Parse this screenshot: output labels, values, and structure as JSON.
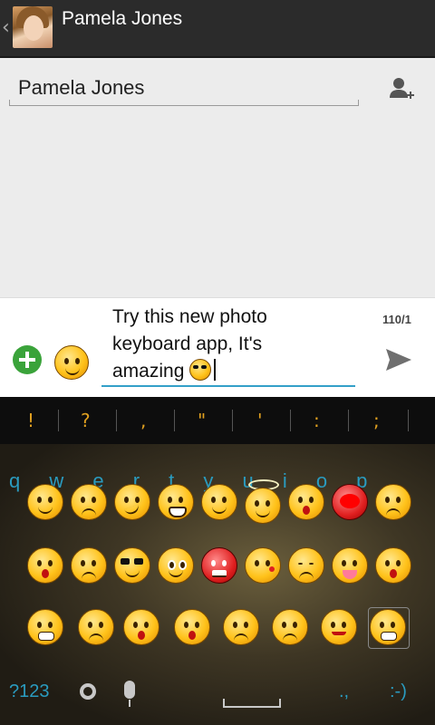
{
  "header": {
    "back_icon": "chevron-left-icon",
    "contact_name": "Pamela Jones"
  },
  "recipient": {
    "value": "Pamela Jones",
    "add_contact_icon": "add-person-icon"
  },
  "compose": {
    "message": "Try this new photo keyboard app, It's amazing",
    "counter": "110/1",
    "add_icon": "plus-circle-icon",
    "emoji_icon": "smiley-icon",
    "send_icon": "send-icon"
  },
  "keyboard": {
    "punctuation": [
      "!",
      "?",
      ",",
      "\"",
      "'",
      ":",
      ";"
    ],
    "ghost_letters": "q w e r t y u i o p",
    "symbols_label": "?123",
    "comma_label": ".,",
    "smiley_label": ":-)",
    "colors": {
      "accent": "#2a9bbf",
      "punct": "#e0a020"
    }
  }
}
